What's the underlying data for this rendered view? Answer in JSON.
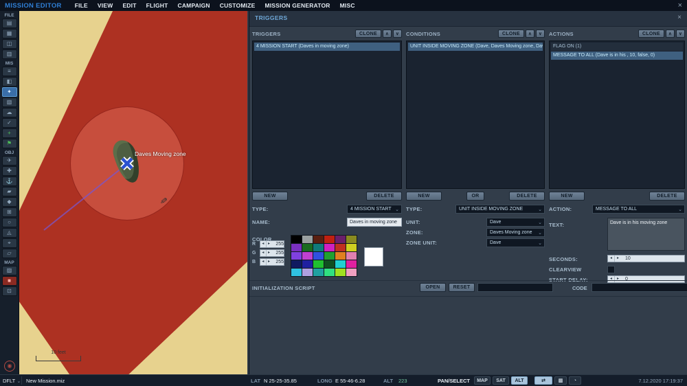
{
  "window": {
    "close_label": "×"
  },
  "icons": {
    "up": "∧",
    "down": "∨",
    "dd_chev": "⌄",
    "left_arrow": "◂",
    "right_arrow": "▸",
    "dflt_chev": "⌄",
    "measure": "⇄",
    "layers": "▥",
    "clock": "◔",
    "pencil": "✎"
  },
  "menu": {
    "title": "MISSION EDITOR",
    "items": [
      "FILE",
      "VIEW",
      "EDIT",
      "FLIGHT",
      "CAMPAIGN",
      "CUSTOMIZE",
      "MISSION GENERATOR",
      "MISC"
    ]
  },
  "sidebar": {
    "sections": [
      {
        "label": "FILE",
        "icons": [
          {
            "name": "new-mission-icon",
            "glyph": "▤"
          },
          {
            "name": "open-mission-icon",
            "glyph": "▦"
          },
          {
            "name": "save-mission-icon",
            "glyph": "◫"
          },
          {
            "name": "save-as-icon",
            "glyph": "▥"
          }
        ]
      },
      {
        "label": "MIS",
        "icons": [
          {
            "name": "briefing-icon",
            "glyph": "≡"
          },
          {
            "name": "mission-options-icon",
            "glyph": "◧"
          },
          {
            "name": "triggers-icon",
            "glyph": "✦",
            "state": "active"
          },
          {
            "name": "rules-icon",
            "glyph": "▧"
          },
          {
            "name": "weather-icon",
            "glyph": "☁"
          },
          {
            "name": "goals-icon",
            "glyph": "✓"
          },
          {
            "name": "add-unit-icon",
            "glyph": "+",
            "state": "green"
          },
          {
            "name": "flag-icon",
            "glyph": "⚑",
            "state": "green"
          }
        ]
      },
      {
        "label": "OBJ",
        "icons": [
          {
            "name": "airplane-icon",
            "glyph": "✈"
          },
          {
            "name": "helicopter-icon",
            "glyph": "✚"
          },
          {
            "name": "ship-icon",
            "glyph": "⚓"
          },
          {
            "name": "vehicle-icon",
            "glyph": "▰"
          },
          {
            "name": "static-object-icon",
            "glyph": "◆"
          },
          {
            "name": "template-icon",
            "glyph": "⊞"
          },
          {
            "name": "zone-icon",
            "glyph": "○"
          },
          {
            "name": "waypoint-icon",
            "glyph": "◬"
          },
          {
            "name": "measure-tool-icon",
            "glyph": "⌖"
          },
          {
            "name": "label-tool-icon",
            "glyph": "▱"
          }
        ]
      },
      {
        "label": "MAP",
        "icons": [
          {
            "name": "map-layers-icon",
            "glyph": "▨"
          },
          {
            "name": "record-icon",
            "glyph": "■",
            "state": "red"
          },
          {
            "name": "map-options-icon",
            "glyph": "⊡"
          }
        ]
      }
    ],
    "bottom_icon": {
      "name": "exit-icon",
      "glyph": "◉"
    }
  },
  "map": {
    "zone_label": "Daves Moving zone",
    "scale_label": "10 feet"
  },
  "panel": {
    "title": "TRIGGERS",
    "close_label": "×",
    "palette": [
      "#000000",
      "#9aa0a0",
      "#5a1f10",
      "#c02010",
      "#6a1f6a",
      "#8a8a20",
      "#7a30c0",
      "#1a6a20",
      "#107a7a",
      "#d020c0",
      "#c03020",
      "#d0d020",
      "#8040e0",
      "#c040d0",
      "#3050e0",
      "#20a030",
      "#e08020",
      "#e080b0",
      "#101a60",
      "#2020a0",
      "#20c030",
      "#105020",
      "#20d0d0",
      "#e020a0",
      "#30c0e0",
      "#b0a0e0",
      "#20a0a0",
      "#30e080",
      "#a0e020",
      "#f0a0c0"
    ],
    "color_preview": "#ffffff",
    "triggers": {
      "header": "TRIGGERS",
      "clone_label": "CLONE",
      "items": [
        {
          "text": "4 MISSION START (Daves in moving zone)"
        }
      ],
      "new_label": "NEW",
      "delete_label": "DELETE",
      "type_label": "TYPE:",
      "type_value": "4 MISSION START",
      "name_label": "NAME:",
      "name_value": "Daves in moving zone",
      "color_label": "COLOR",
      "r_label": "R",
      "g_label": "G",
      "b_label": "B",
      "r": "255",
      "g": "255",
      "b": "255"
    },
    "conditions": {
      "header": "CONDITIONS",
      "clone_label": "CLONE",
      "items": [
        {
          "text": "UNIT INSIDE MOVING ZONE (Dave, Daves Moving zone, Dave)"
        }
      ],
      "new_label": "NEW",
      "or_label": "OR",
      "delete_label": "DELETE",
      "type_label": "TYPE:",
      "type_value": "UNIT INSIDE MOVING ZONE",
      "unit_label": "UNIT:",
      "unit_value": "Dave",
      "zone_label": "ZONE:",
      "zone_value": "Daves Moving zone",
      "zone_unit_label": "ZONE UNIT:",
      "zone_unit_value": "Dave"
    },
    "actions": {
      "header": "ACTIONS",
      "clone_label": "CLONE",
      "items": [
        {
          "text": "FLAG ON (1)"
        },
        {
          "text": "MESSAGE TO ALL (Dave is in his , 10, false, 0)"
        }
      ],
      "new_label": "NEW",
      "delete_label": "DELETE",
      "action_label": "ACTION:",
      "action_value": "MESSAGE TO ALL",
      "text_label": "TEXT:",
      "text_value": "Dave is in his moving zone",
      "seconds_label": "SECONDS:",
      "seconds_value": "10",
      "clearview_label": "CLEARVIEW",
      "start_delay_label": "START DELAY:",
      "start_delay_value": "0"
    },
    "init_script": {
      "label": "INITIALIZATION SCRIPT",
      "open_label": "OPEN",
      "reset_label": "RESET",
      "code_label": "CODE",
      "script_value": "",
      "code_value": ""
    }
  },
  "statusbar": {
    "profile": "DFLT",
    "mission_file": "New Mission.miz",
    "lat_label": "LAT",
    "lat_value": "N 25-25-35.85",
    "long_label": "LONG",
    "long_value": "E 55-46-6.28",
    "alt_label": "ALT",
    "alt_value": "223",
    "mode_label": "PAN/SELECT",
    "map_button": "MAP",
    "sat_button": "SAT",
    "alt_button": "ALT",
    "datetime": "7.12.2020 17:19:37"
  }
}
